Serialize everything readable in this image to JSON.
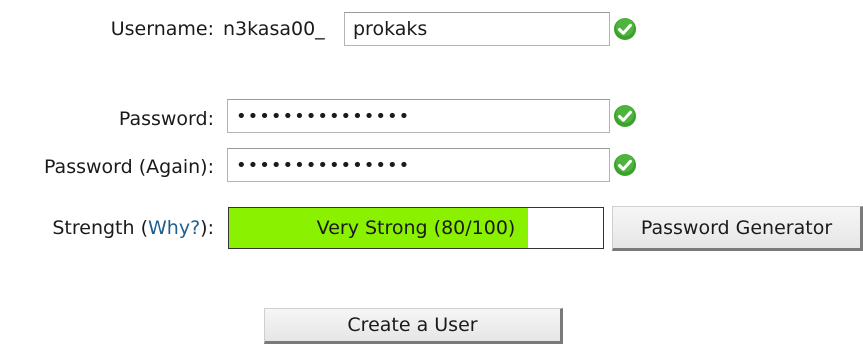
{
  "form": {
    "username": {
      "label": "Username:",
      "prefix": "n3kasa00_",
      "value": "prokaks",
      "valid_icon": "check-circle-icon"
    },
    "password": {
      "label": "Password:",
      "value": "•••••••••••••••",
      "valid_icon": "check-circle-icon"
    },
    "password_again": {
      "label": "Password (Again):",
      "value": "•••••••••••••••",
      "valid_icon": "check-circle-icon"
    },
    "strength": {
      "label": "Strength (",
      "why_link": "Why?",
      "label_suffix": "):",
      "text": "Very Strong (80/100)",
      "score": 80,
      "max": 100,
      "fill_color": "#8af200"
    },
    "generator_button": "Password Generator",
    "create_button": "Create a User"
  },
  "colors": {
    "valid_green": "#3aa12b",
    "link": "#1f5f8f"
  }
}
